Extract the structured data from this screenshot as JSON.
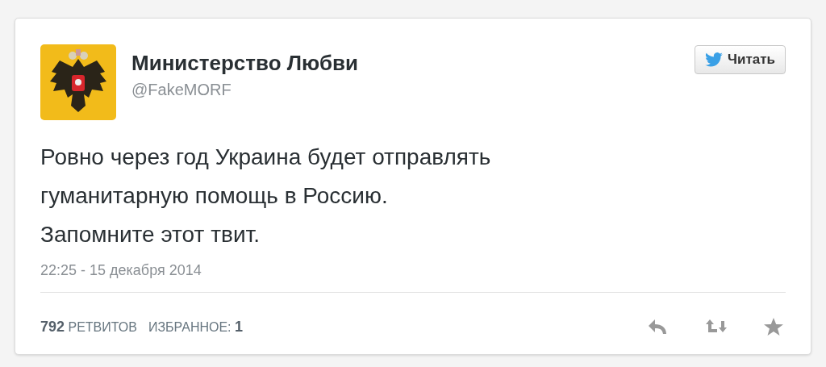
{
  "tweet": {
    "author": {
      "name": "Министерство Любви",
      "handle": "@FakeMORF"
    },
    "follow_button": {
      "label": "Читать"
    },
    "text_lines": [
      "Ровно через год Украина будет отправлять",
      "гуманитарную помощь в Россию.",
      "Запомните этот твит."
    ],
    "timestamp": "22:25 - 15 декабря 2014",
    "stats": [
      "**792** РЕТВИТОВ",
      "ИЗБРАННОЕ: **1**"
    ],
    "actions": [
      {
        "kind": "reply"
      },
      {
        "kind": "retweet"
      },
      {
        "kind": "favorite"
      }
    ]
  }
}
